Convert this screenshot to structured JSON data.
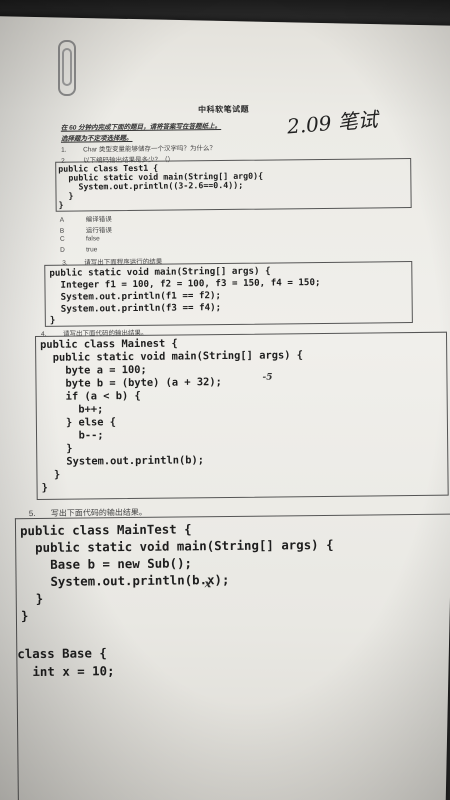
{
  "paper": {
    "title": "中科软笔试题",
    "handwritten_note": "2.09 笔试",
    "instruction_lines": [
      "在 60 分钟内完成下面的题目，请将答案写在答题纸上。",
      "选择题为不定项选择题。"
    ]
  },
  "questions": [
    {
      "num": "1.",
      "text": "Char 类型变量能够储存一个汉字吗？为什么？"
    },
    {
      "num": "2.",
      "text": "以下编码输出结果是多少？（）"
    },
    {
      "num": "3.",
      "text": "请写出下面程序运行的结果"
    },
    {
      "num": "4.",
      "text": "请写出下面代码的输出结果。"
    },
    {
      "num": "5.",
      "text": "写出下面代码的输出结果。"
    }
  ],
  "q2_options": [
    {
      "letter": "A",
      "text": "编译错误"
    },
    {
      "letter": "B",
      "text": "运行错误"
    },
    {
      "letter": "C",
      "text": "false"
    },
    {
      "letter": "D",
      "text": "true"
    }
  ],
  "code": {
    "q2": [
      "public class Test1 {",
      "  public static void main(String[] arg0){",
      "    System.out.println((3-2.6==0.4));",
      "  }",
      "}"
    ],
    "q3": [
      "public static void main(String[] args) {",
      "  Integer f1 = 100, f2 = 100, f3 = 150, f4 = 150;",
      "  System.out.println(f1 == f2);",
      "  System.out.println(f3 == f4);",
      "}"
    ],
    "q4": [
      "public class Mainest {",
      "  public static void main(String[] args) {",
      "    byte a = 100;",
      "    byte b = (byte) (a + 32);",
      "    if (a < b) {",
      "      b++;",
      "    } else {",
      "      b--;",
      "    }",
      "    System.out.println(b);",
      "  }",
      "}"
    ],
    "q5": [
      "public class MainTest {",
      "  public static void main(String[] args) {",
      "    Base b = new Sub();",
      "    System.out.println(b.x);",
      "  }",
      "}",
      "",
      "class Base {",
      "  int x = 10;"
    ]
  },
  "pen_marks": {
    "q4_mark": "-5",
    "q5_mark": "x"
  }
}
